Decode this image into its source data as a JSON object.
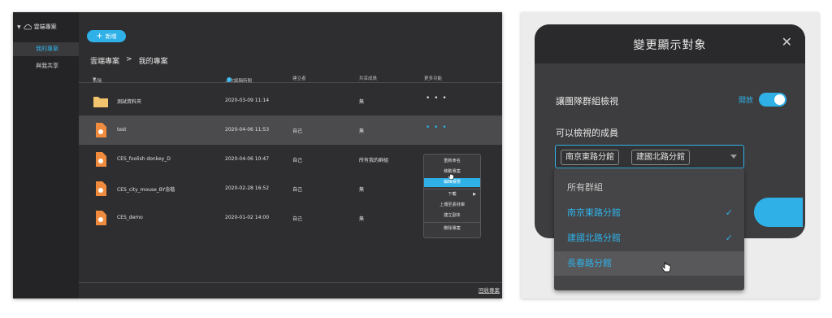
{
  "file_manager": {
    "sidebar": {
      "title": "雲端專案",
      "items": [
        {
          "label": "我的專案",
          "active": true
        },
        {
          "label": "與我共享",
          "active": false
        }
      ]
    },
    "new_button_label": "新增",
    "breadcrumb": {
      "root": "雲端專案",
      "separator": ">",
      "current": "我的專案"
    },
    "columns": {
      "name": "名稱",
      "modified": "上次編輯時間",
      "creator": "建立者",
      "shared": "共享成員",
      "more": "更多功能"
    },
    "rows": [
      {
        "name": "測試資料夾",
        "type": "folder",
        "modified": "2020-03-09 11:14",
        "creator": "",
        "shared": "無",
        "more": "• • •"
      },
      {
        "name": "test",
        "type": "file",
        "modified": "2020-04-06 11:53",
        "creator": "自己",
        "shared": "無",
        "more": "• • •",
        "highlighted": true
      },
      {
        "name": "CES_foolish donkey_D",
        "type": "file",
        "modified": "2020-04-06 10:47",
        "creator": "自己",
        "shared": "所有我的群組",
        "more": ""
      },
      {
        "name": "CES_city_mouse_BY念楷",
        "type": "file",
        "modified": "2020-02-28 16:52",
        "creator": "自己",
        "shared": "無",
        "more": ""
      },
      {
        "name": "CES_demo",
        "type": "file",
        "modified": "2020-01-02 14:00",
        "creator": "自己",
        "shared": "無",
        "more": ""
      }
    ],
    "context_menu": {
      "items": [
        "重新命名",
        "移動專案",
        "編輯權限",
        "下載",
        "上傳至素材庫",
        "建立副本",
        "刪除專案"
      ],
      "highlighted": "編輯權限"
    },
    "recycle_link": "回收專案"
  },
  "visibility_modal": {
    "title": "變更顯示對象",
    "close_glyph": "✕",
    "team_view_label": "讓團隊群組檢視",
    "toggle_label": "開放",
    "toggle_on": true,
    "members_label": "可以檢視的成員",
    "chips": [
      "南京東路分館",
      "建國北路分館"
    ],
    "dropdown": {
      "header": "所有群組",
      "options": [
        {
          "label": "南京東路分館",
          "checked": true,
          "check_glyph": "✓"
        },
        {
          "label": "建國北路分館",
          "checked": true,
          "check_glyph": "✓"
        },
        {
          "label": "長春路分館",
          "checked": false,
          "hovered": true
        }
      ]
    }
  },
  "colors": {
    "accent": "#2fb1e8",
    "panel_bg": "#2e2e30",
    "sidebar_bg": "#242426",
    "folder": "#f2c46e",
    "file": "#f08a3c"
  }
}
